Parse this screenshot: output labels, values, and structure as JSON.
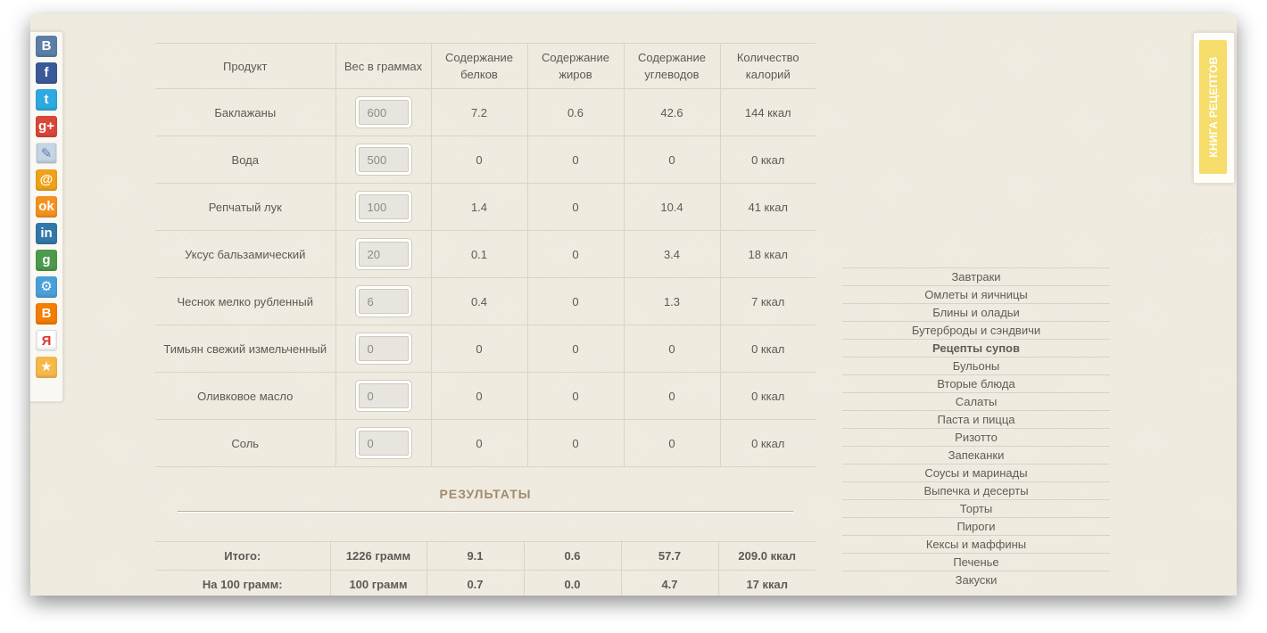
{
  "social_icons": [
    {
      "name": "vk-icon",
      "glyph": "B",
      "color": "#5b7fa6"
    },
    {
      "name": "facebook-icon",
      "glyph": "f",
      "color": "#3b5998"
    },
    {
      "name": "twitter-icon",
      "glyph": "t",
      "color": "#2daae1"
    },
    {
      "name": "google-plus-icon",
      "glyph": "g+",
      "color": "#d9473b"
    },
    {
      "name": "livejournal-icon",
      "glyph": "✎",
      "color": "#c6d4e6"
    },
    {
      "name": "mail-ru-icon",
      "glyph": "@",
      "color": "#f0a21a"
    },
    {
      "name": "odnoklassniki-icon",
      "glyph": "ok",
      "color": "#f39220"
    },
    {
      "name": "linkedin-icon",
      "glyph": "in",
      "color": "#3178ab"
    },
    {
      "name": "google-bookmarks-icon",
      "glyph": "g",
      "color": "#4c9a4c"
    },
    {
      "name": "settings-icon",
      "glyph": "⚙",
      "color": "#4a9fd9"
    },
    {
      "name": "blogger-icon",
      "glyph": "B",
      "color": "#f57d00"
    },
    {
      "name": "yandex-icon",
      "glyph": "Я",
      "color": "#ffffff"
    },
    {
      "name": "favorites-icon",
      "glyph": "★",
      "color": "#f5b94a"
    }
  ],
  "book_tab": {
    "label": "КНИГА РЕЦЕПТОВ"
  },
  "product_table": {
    "headers": [
      "Продукт",
      "Вес в граммах",
      "Содержание белков",
      "Содержание жиров",
      "Содержание углеводов",
      "Количество калорий"
    ],
    "rows": [
      {
        "product": "Баклажаны",
        "weight": "600",
        "protein": "7.2",
        "fat": "0.6",
        "carbs": "42.6",
        "kcal": "144 ккал"
      },
      {
        "product": "Вода",
        "weight": "500",
        "protein": "0",
        "fat": "0",
        "carbs": "0",
        "kcal": "0 ккал"
      },
      {
        "product": "Репчатый лук",
        "weight": "100",
        "protein": "1.4",
        "fat": "0",
        "carbs": "10.4",
        "kcal": "41 ккал"
      },
      {
        "product": "Уксус бальзамический",
        "weight": "20",
        "protein": "0.1",
        "fat": "0",
        "carbs": "3.4",
        "kcal": "18 ккал"
      },
      {
        "product": "Чеснок мелко рубленный",
        "weight": "6",
        "protein": "0.4",
        "fat": "0",
        "carbs": "1.3",
        "kcal": "7 ккал"
      },
      {
        "product": "Тимьян свежий измельченный",
        "weight": "0",
        "protein": "0",
        "fat": "0",
        "carbs": "0",
        "kcal": "0 ккал"
      },
      {
        "product": "Оливковое масло",
        "weight": "0",
        "protein": "0",
        "fat": "0",
        "carbs": "0",
        "kcal": "0 ккал"
      },
      {
        "product": "Соль",
        "weight": "0",
        "protein": "0",
        "fat": "0",
        "carbs": "0",
        "kcal": "0 ккал"
      }
    ]
  },
  "results": {
    "heading": "РЕЗУЛЬТАТЫ",
    "rows": [
      {
        "label": "Итого:",
        "weight": "1226 грамм",
        "protein": "9.1",
        "fat": "0.6",
        "carbs": "57.7",
        "kcal": "209.0 ккал"
      },
      {
        "label": "На 100 грамм:",
        "weight": "100 грамм",
        "protein": "0.7",
        "fat": "0.0",
        "carbs": "4.7",
        "kcal": "17 ккал"
      }
    ]
  },
  "categories": [
    {
      "label": "Завтраки",
      "bold": false
    },
    {
      "label": "Омлеты и яичницы",
      "bold": false
    },
    {
      "label": "Блины и оладьи",
      "bold": false
    },
    {
      "label": "Бутерброды и сэндвичи",
      "bold": false
    },
    {
      "label": "Рецепты супов",
      "bold": true
    },
    {
      "label": "Бульоны",
      "bold": false
    },
    {
      "label": "Вторые блюда",
      "bold": false
    },
    {
      "label": "Салаты",
      "bold": false
    },
    {
      "label": "Паста и пицца",
      "bold": false
    },
    {
      "label": "Ризотто",
      "bold": false
    },
    {
      "label": "Запеканки",
      "bold": false
    },
    {
      "label": "Соусы и маринады",
      "bold": false
    },
    {
      "label": "Выпечка и десерты",
      "bold": false
    },
    {
      "label": "Торты",
      "bold": false
    },
    {
      "label": "Пироги",
      "bold": false
    },
    {
      "label": "Кексы и маффины",
      "bold": false
    },
    {
      "label": "Печенье",
      "bold": false
    },
    {
      "label": "Закуски",
      "bold": false
    }
  ]
}
